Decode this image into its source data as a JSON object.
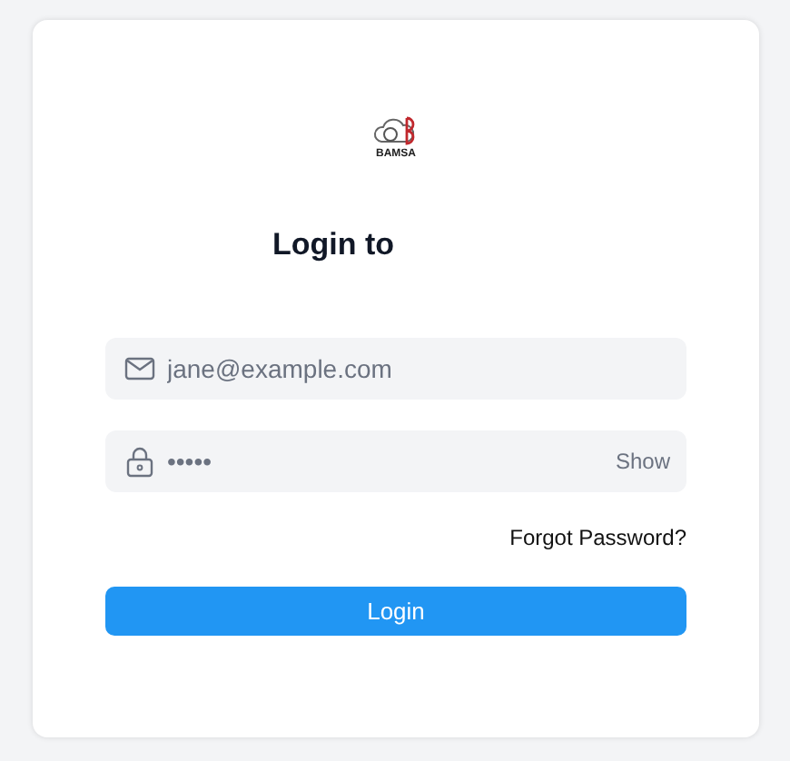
{
  "logo": {
    "text": "BAMSA"
  },
  "title": "Login to",
  "email_field": {
    "placeholder": "jane@example.com"
  },
  "password_field": {
    "value": "•••••",
    "toggle": "Show"
  },
  "forgot_link": "Forgot Password?",
  "login_button": "Login"
}
